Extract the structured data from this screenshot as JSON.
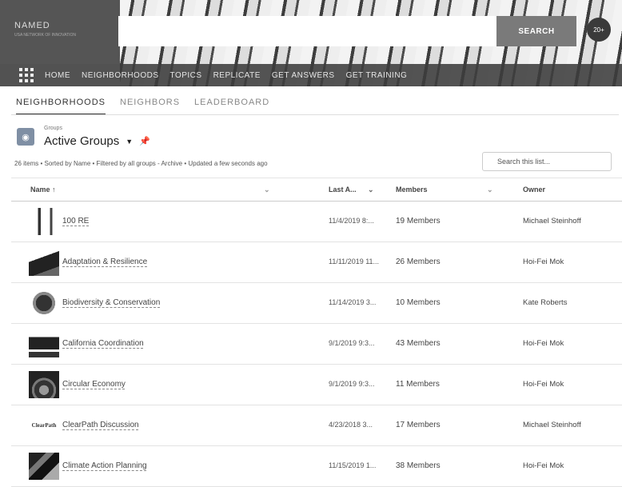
{
  "header": {
    "logo_text": "NAMED",
    "logo_tagline": "USA NETWORK OF INNOVATION",
    "search_button": "SEARCH",
    "extra_badge": "20+"
  },
  "nav": {
    "items": [
      "HOME",
      "NEIGHBORHOODS",
      "TOPICS",
      "REPLICATE",
      "GET ANSWERS",
      "GET TRAINING"
    ]
  },
  "tabs": [
    "NEIGHBORHOODS",
    "NEIGHBORS",
    "LEADERBOARD"
  ],
  "list": {
    "object_label": "Groups",
    "title": "Active Groups",
    "meta": "26 items • Sorted by Name • Filtered by all groups - Archive • Updated a few seconds ago",
    "search_placeholder": "Search this list..."
  },
  "columns": {
    "name": "Name ↑",
    "last": "Last A...",
    "members": "Members",
    "owner": "Owner"
  },
  "rows": [
    {
      "name": "100 RE",
      "date": "11/4/2019 8:...",
      "members": "19 Members",
      "owner": "Michael Steinhoff"
    },
    {
      "name": "Adaptation & Resilience",
      "date": "11/11/2019 11...",
      "members": "26 Members",
      "owner": "Hoi-Fei Mok"
    },
    {
      "name": "Biodiversity & Conservation",
      "date": "11/14/2019 3...",
      "members": "10 Members",
      "owner": "Kate Roberts"
    },
    {
      "name": "California Coordination",
      "date": "9/1/2019 9:3...",
      "members": "43 Members",
      "owner": "Hoi-Fei Mok"
    },
    {
      "name": "Circular Economy",
      "date": "9/1/2019 9:3...",
      "members": "11 Members",
      "owner": "Hoi-Fei Mok"
    },
    {
      "name": "ClearPath Discussion",
      "date": "4/23/2018 3...",
      "members": "17 Members",
      "owner": "Michael Steinhoff"
    },
    {
      "name": "Climate Action Planning",
      "date": "11/15/2019 1...",
      "members": "38 Members",
      "owner": "Hoi-Fei Mok"
    }
  ]
}
